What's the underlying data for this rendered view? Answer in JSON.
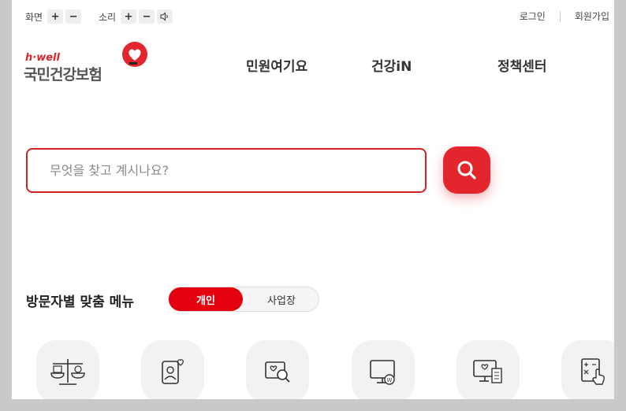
{
  "utility": {
    "screen_label": "화면",
    "sound_label": "소리",
    "plus": "+",
    "minus": "−",
    "login": "로그인",
    "signup": "회원가입"
  },
  "logo": {
    "brand": "h·well",
    "name": "국민건강보험"
  },
  "nav": {
    "items": [
      "민원여기요",
      "건강iN",
      "정책센터"
    ]
  },
  "search": {
    "placeholder": "무엇을 찾고 계시나요?"
  },
  "visitor_menu": {
    "title": "방문자별 맞춤 메뉴",
    "options": [
      "개인",
      "사업장"
    ],
    "active": "개인"
  },
  "tiles": [
    {
      "icon": "scale-icon"
    },
    {
      "icon": "profile-heart-icon"
    },
    {
      "icon": "search-heart-icon"
    },
    {
      "icon": "monitor-won-icon"
    },
    {
      "icon": "monitor-receipt-icon"
    },
    {
      "icon": "calculator-hand-icon"
    }
  ],
  "colors": {
    "accent": "#e3262d",
    "border_red": "#d42027",
    "text_dark": "#333333",
    "tile_bg": "#f2f2f2"
  }
}
